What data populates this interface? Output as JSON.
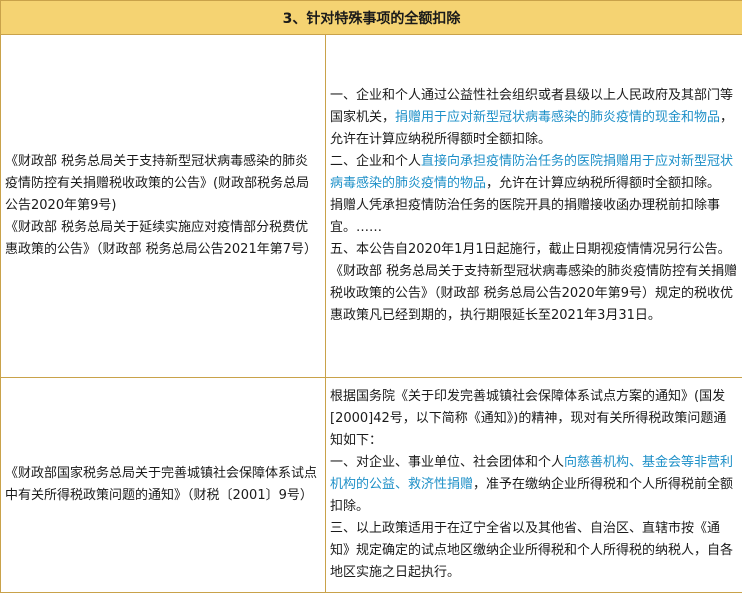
{
  "header": {
    "title": "3、针对特殊事项的全额扣除"
  },
  "rows": [
    {
      "left": [
        "《财政部 税务总局关于支持新型冠状病毒感染的肺炎疫情防控有关捐赠税收政策的公告》(财政部税务总局公告2020年第9号)",
        "《财政部 税务总局关于延续实施应对疫情部分税费优惠政策的公告》（财政部 税务总局公告2021年第7号）"
      ],
      "right": {
        "p1_a": "一、企业和个人通过公益性社会组织或者县级以上人民政府及其部门等国家机关，",
        "p1_b": "捐赠用于应对新型冠状病毒感染的肺炎疫情的现金和物品",
        "p1_c": "，允许在计算应纳税所得额时全额扣除。",
        "p2_a": "二、企业和个人",
        "p2_b": "直接向承担疫情防治任务的医院捐赠用于应对新型冠状病毒感染的肺炎疫情的物品",
        "p2_c": "，允许在计算应纳税所得额时全额扣除。",
        "p3": "捐赠人凭承担疫情防治任务的医院开具的捐赠接收函办理税前扣除事宜。……",
        "p4": "五、本公告自2020年1月1日起施行，截止日期视疫情情况另行公告。",
        "p5": "《财政部 税务总局关于支持新型冠状病毒感染的肺炎疫情防控有关捐赠税收政策的公告》（财政部 税务总局公告2020年第9号）规定的税收优惠政策凡已经到期的，执行期限延长至2021年3月31日。"
      }
    },
    {
      "left": [
        "《财政部国家税务总局关于完善城镇社会保障体系试点中有关所得税政策问题的通知》（财税〔2001〕9号）"
      ],
      "right": {
        "p1": "根据国务院《关于印发完善城镇社会保障体系试点方案的通知》(国发[2000]42号，以下简称《通知》)的精神，现对有关所得税政策问题通知如下：",
        "p2_a": "一、对企业、事业单位、社会团体和个人",
        "p2_b": "向慈善机构、基金会等非营利机构的公益、救济性捐赠",
        "p2_c": "，准予在缴纳企业所得税和个人所得税前全额扣除。",
        "p3": "三、以上政策适用于在辽宁全省以及其他省、自治区、直辖市按《通知》规定确定的试点地区缴纳企业所得税和个人所得税的纳税人，自各地区实施之日起执行。"
      }
    }
  ],
  "colors": {
    "header_bg": "#f5d372",
    "border": "#c9a24a",
    "highlight_text": "#1e90c8"
  }
}
